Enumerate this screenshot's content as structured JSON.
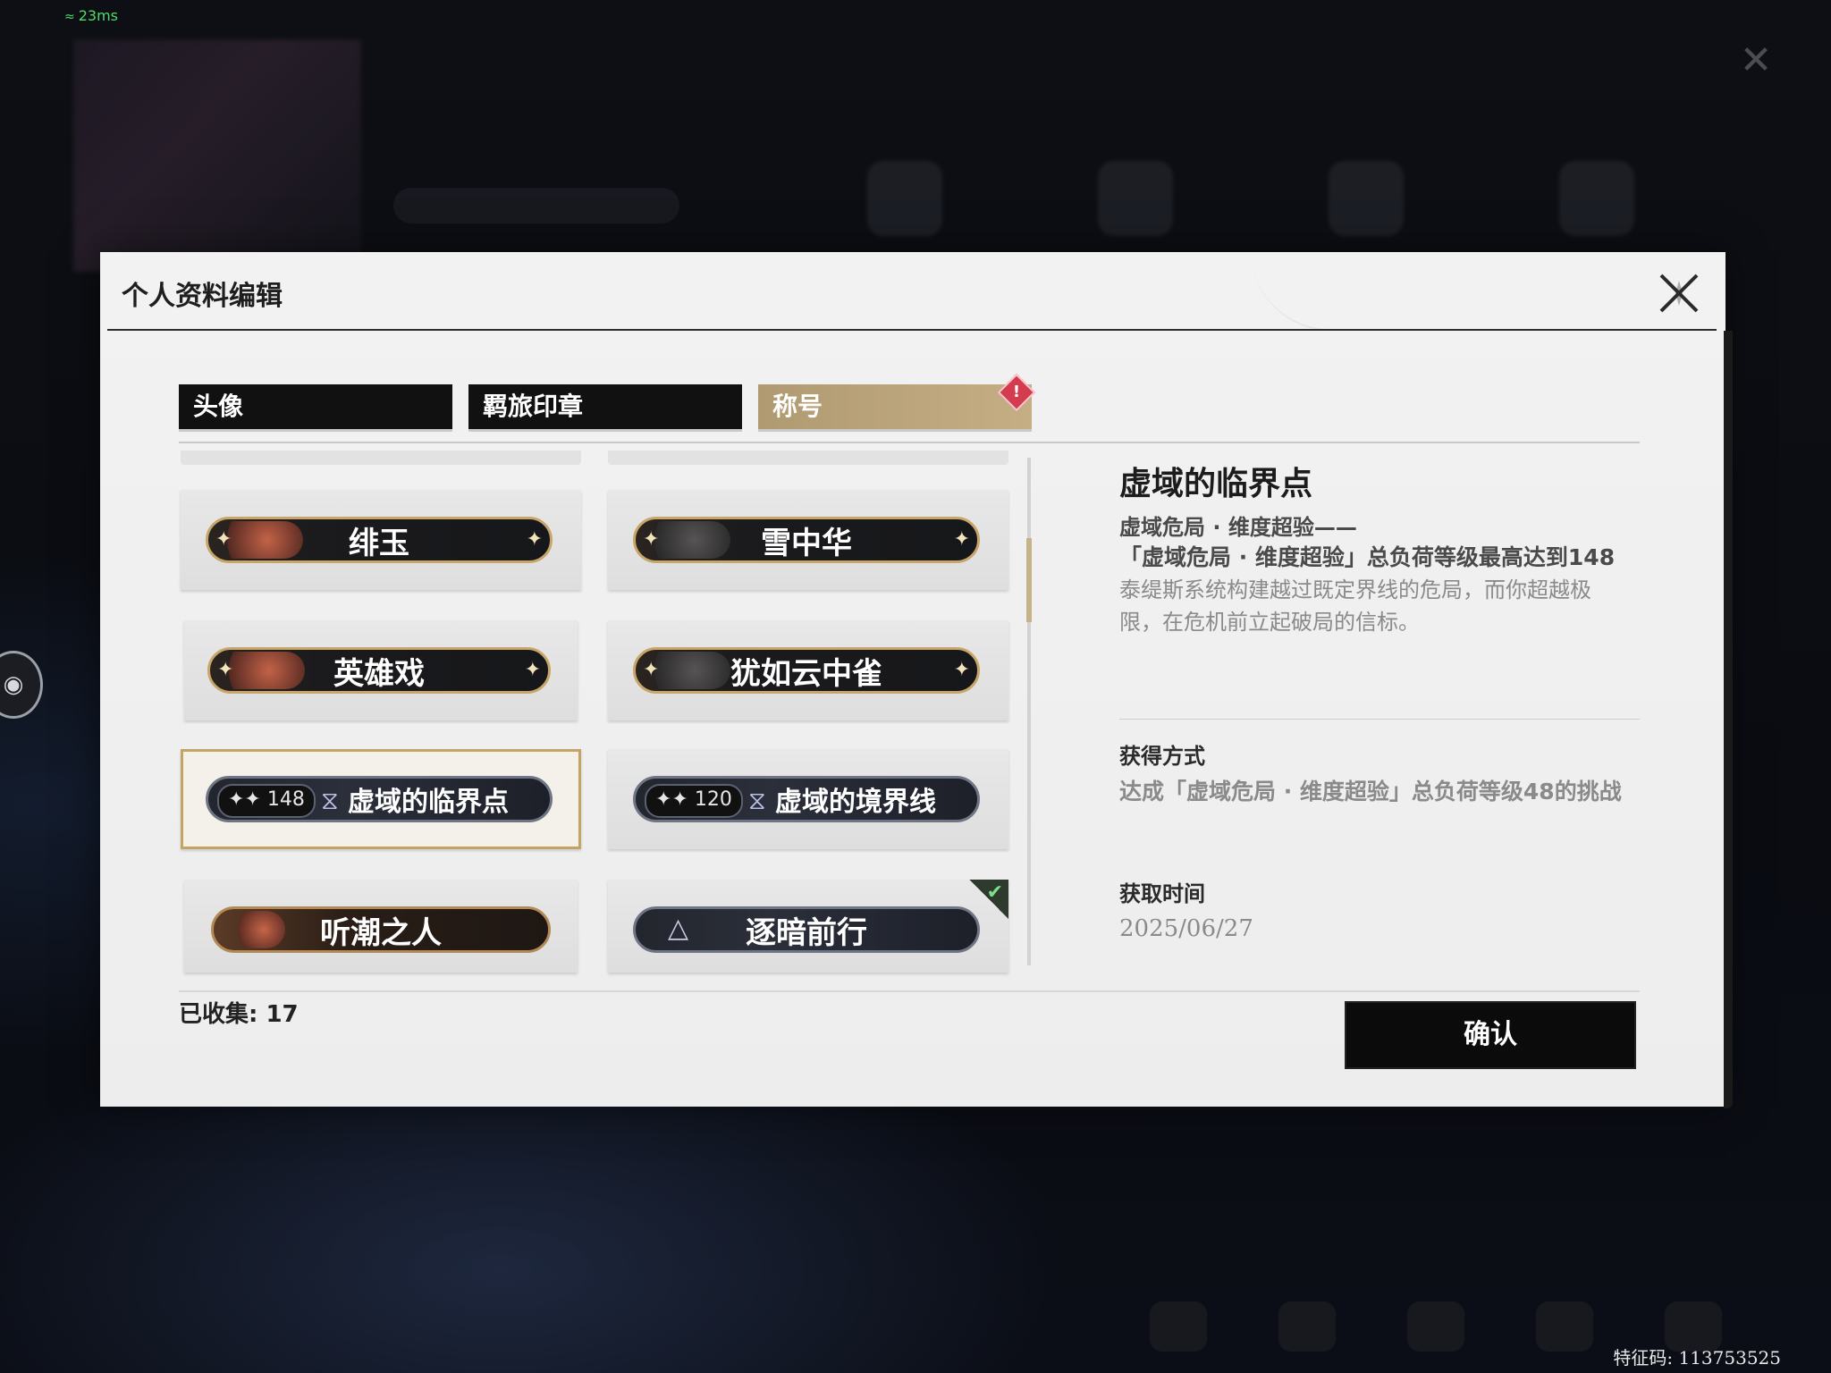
{
  "status": {
    "latency": "23ms",
    "feature_code": "特征码: 113753525"
  },
  "dialog": {
    "title": "个人资料编辑",
    "tabs": [
      {
        "label": "头像"
      },
      {
        "label": "羁旅印章"
      },
      {
        "label": "称号",
        "active": true,
        "alert": "!"
      }
    ],
    "titles": [
      {
        "label": "绯玉",
        "style": "portrait"
      },
      {
        "label": "雪中华",
        "style": "portrait-dark"
      },
      {
        "label": "英雄戏",
        "style": "portrait"
      },
      {
        "label": "犹如云中雀",
        "style": "portrait-dark"
      },
      {
        "label": "虚域的临界点",
        "level": "148",
        "style": "level",
        "selected": true
      },
      {
        "label": "虚域的境界线",
        "level": "120",
        "style": "level"
      },
      {
        "label": "听潮之人",
        "style": "brown"
      },
      {
        "label": "逐暗前行",
        "style": "blue",
        "checked": true
      }
    ],
    "collected": "已收集: 17",
    "detail": {
      "name": "虚域的临界点",
      "subtitle": "虚域危局 · 维度超验——",
      "condition": "「虚域危局 · 维度超验」总负荷等级最高达到148",
      "description": "泰缇斯系统构建越过既定界线的危局，而你超越极限，在危机前立起破局的信标。",
      "obtain_label": "获得方式",
      "obtain_value": "达成「虚域危局 · 维度超验」总负荷等级48的挑战",
      "time_label": "获取时间",
      "time_value": "2025/06/27"
    },
    "confirm_label": "确认"
  },
  "icons": {
    "close": "close-x-icon",
    "alert": "alert-diamond-icon",
    "check": "check-corner-icon",
    "sparkle": "sparkle-icon",
    "sigil": "hourglass-sigil-icon"
  },
  "colors": {
    "accent_gold": "#c5ae84",
    "dialog_bg": "#f0f0f0",
    "button_bg": "#0b0b0b"
  }
}
